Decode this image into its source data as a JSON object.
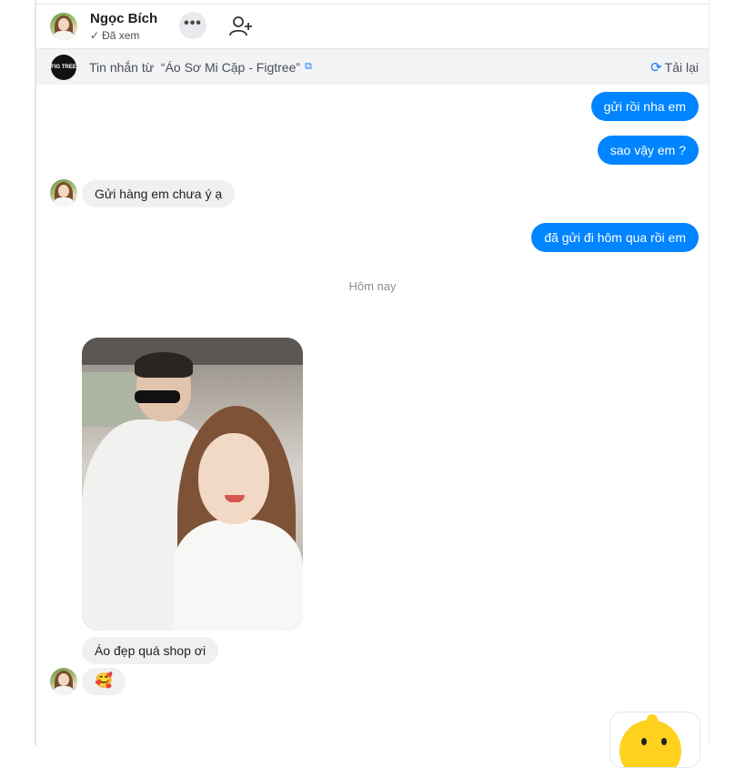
{
  "header": {
    "contact_name": "Ngọc Bích",
    "status": "Đã xem",
    "status_check": "✓",
    "more_label": "•••"
  },
  "banner": {
    "prefix": "Tin nhắn từ",
    "shop_name": "“Áo Sơ Mi Cặp - Figtree”",
    "reload_label": "Tải lại",
    "reload_icon": "⟳",
    "external_icon": "⧉",
    "logo_text": "FIG TREE"
  },
  "messages": {
    "out_1": "gửi rồi nha em",
    "out_2": "sao vậy em ?",
    "in_1": "Gửi hàng em chưa ý ạ",
    "out_3": "đã gửi đi hôm qua rồi em",
    "date_separator": "Hôm nay",
    "in_2": "Áo đẹp quá shop ơi",
    "in_3_emoji": "🥰"
  },
  "colors": {
    "outgoing_bubble": "#0084ff",
    "incoming_bubble": "#f0f0f0",
    "accent_blue": "#1877f2",
    "banner_bg": "#f2f3f5"
  }
}
